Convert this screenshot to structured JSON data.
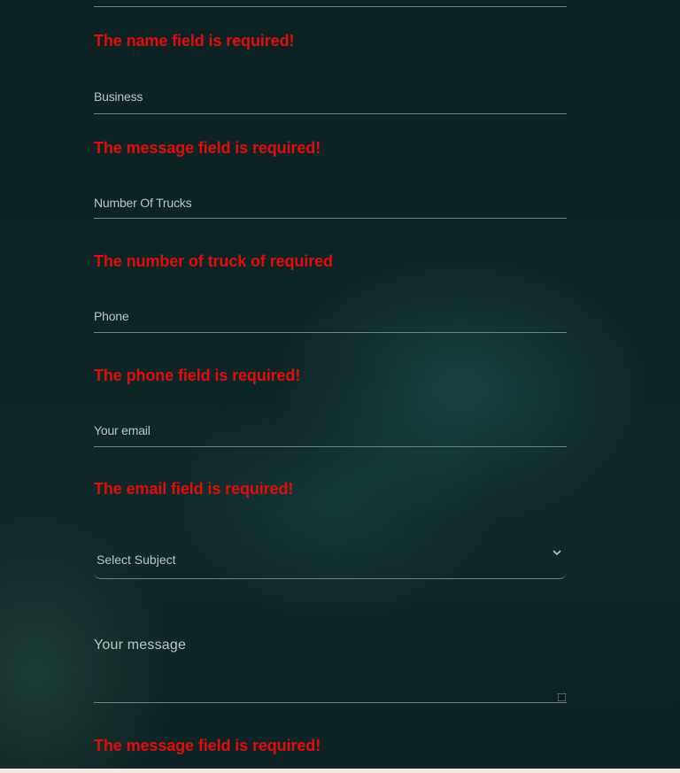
{
  "form": {
    "errors": {
      "name": "The name field is required!",
      "business": "The message field is required!",
      "trucks": "The number of truck of required",
      "phone": "The phone field is required!",
      "email": "The email field is required!",
      "message": "The message field is required!"
    },
    "fields": {
      "business_placeholder": "Business",
      "trucks_placeholder": "Number Of Trucks",
      "phone_placeholder": "Phone",
      "email_placeholder": "Your email",
      "subject_selected": "Select Subject",
      "message_placeholder": "Your message"
    }
  },
  "colors": {
    "error": "#e00d0d",
    "background": "#0e2424",
    "label": "#b9c6c5",
    "underline": "#6c8584"
  },
  "icons": {
    "select": "chevron-down-icon",
    "textarea": "resize-handle-icon"
  }
}
